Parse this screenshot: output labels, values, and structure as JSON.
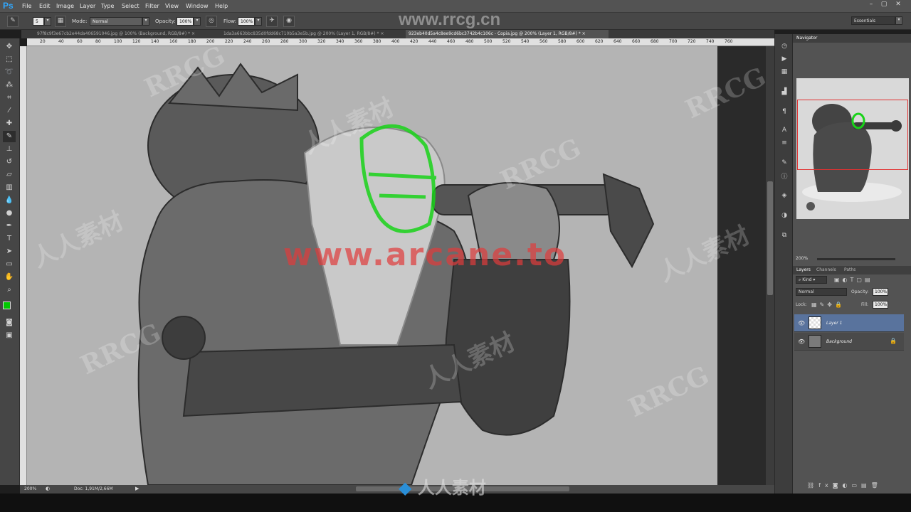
{
  "app": {
    "logo": "Ps"
  },
  "menu": [
    "File",
    "Edit",
    "Image",
    "Layer",
    "Type",
    "Select",
    "Filter",
    "View",
    "Window",
    "Help"
  ],
  "window_controls": {
    "minimize": "–",
    "restore": "▢",
    "close": "✕"
  },
  "options": {
    "brush_size": "5",
    "mode_label": "Mode:",
    "mode_value": "Normal",
    "opacity_label": "Opacity:",
    "opacity_value": "100%",
    "flow_label": "Flow:",
    "flow_value": "100%",
    "workspace": "Essentials"
  },
  "tabs": [
    {
      "label": "97f8c9f3e67cb2e44da406591046.jpg @ 100% (Background, RGB/8#) *",
      "close": "×"
    },
    {
      "label": "1da3a663bbc835d0fdd68c710b5a3e5b.jpg @ 200% (Layer 1, RGB/8#) *",
      "close": "×"
    },
    {
      "label": "923eb40d5a4c8ee9cd6bc3742b4c106c - Copia.jpg @ 200% (Layer 1, RGB/8#) *",
      "close": "×"
    }
  ],
  "ruler": [
    "20",
    "40",
    "60",
    "80",
    "100",
    "120",
    "140",
    "160",
    "180",
    "200",
    "220",
    "240",
    "260",
    "280",
    "300",
    "320",
    "340",
    "360",
    "380",
    "400",
    "420",
    "440",
    "460",
    "480",
    "500",
    "520",
    "540",
    "560",
    "580",
    "600",
    "620",
    "640",
    "660",
    "680",
    "700",
    "720",
    "740",
    "760"
  ],
  "status": {
    "zoom": "200%",
    "doc": "Doc: 1,91M/2,66M"
  },
  "navigator": {
    "title": "Navigator",
    "zoom": "200%"
  },
  "layers_panel": {
    "tabs": [
      "Layers",
      "Channels",
      "Paths"
    ],
    "kind": "Kind",
    "blend_mode": "Normal",
    "opacity_label": "Opacity:",
    "opacity_value": "100%",
    "lock_label": "Lock:",
    "fill_label": "Fill:",
    "fill_value": "100%",
    "layers": [
      {
        "name": "Layer 1",
        "visible": true,
        "selected": true
      },
      {
        "name": "Background",
        "visible": true,
        "locked": true
      }
    ]
  },
  "watermarks": {
    "site": "www.rrcg.cn",
    "overlay": "www.arcane.to",
    "brand": "RRCG",
    "cn": "人人素材"
  },
  "colors": {
    "foreground": "#00c800",
    "background": "#000000",
    "overlay_text": "#e03c3c",
    "selection": "#59739d"
  }
}
